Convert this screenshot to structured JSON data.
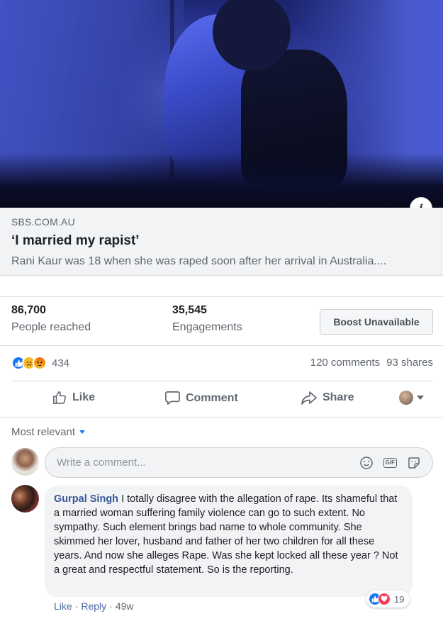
{
  "link_preview": {
    "domain": "SBS.COM.AU",
    "title": "‘I married my rapist’",
    "description": "Rani Kaur was 18 when she was raped soon after her arrival in Australia...."
  },
  "insights": {
    "reach_value": "86,700",
    "reach_label": "People reached",
    "engagements_value": "35,545",
    "engagements_label": "Engagements",
    "boost_label": "Boost Unavailable"
  },
  "reactions": {
    "types": [
      "like",
      "sad",
      "angry"
    ],
    "count": "434",
    "comments": "120 comments",
    "shares": "93 shares"
  },
  "actions": {
    "like": "Like",
    "comment": "Comment",
    "share": "Share"
  },
  "comments": {
    "sort_label": "Most relevant",
    "composer_placeholder": "Write a comment...",
    "items": [
      {
        "author": "Gurpal Singh",
        "text": "I totally disagree with the allegation of rape. Its shameful that a married woman suffering family violence can go to such extent. No sympathy. Such element brings bad name to whole community. She skimmed her lover, husband and father of her two children for all these years. And now she alleges Rape. Was she kept locked all these year ? Not a great and respectful statement. So is the reporting.",
        "reaction_count": "19",
        "like_label": "Like",
        "reply_label": "Reply",
        "age": "49w"
      }
    ]
  },
  "colors": {
    "accent": "#1877f2",
    "author_link": "#385898",
    "love": "#f33e58"
  }
}
